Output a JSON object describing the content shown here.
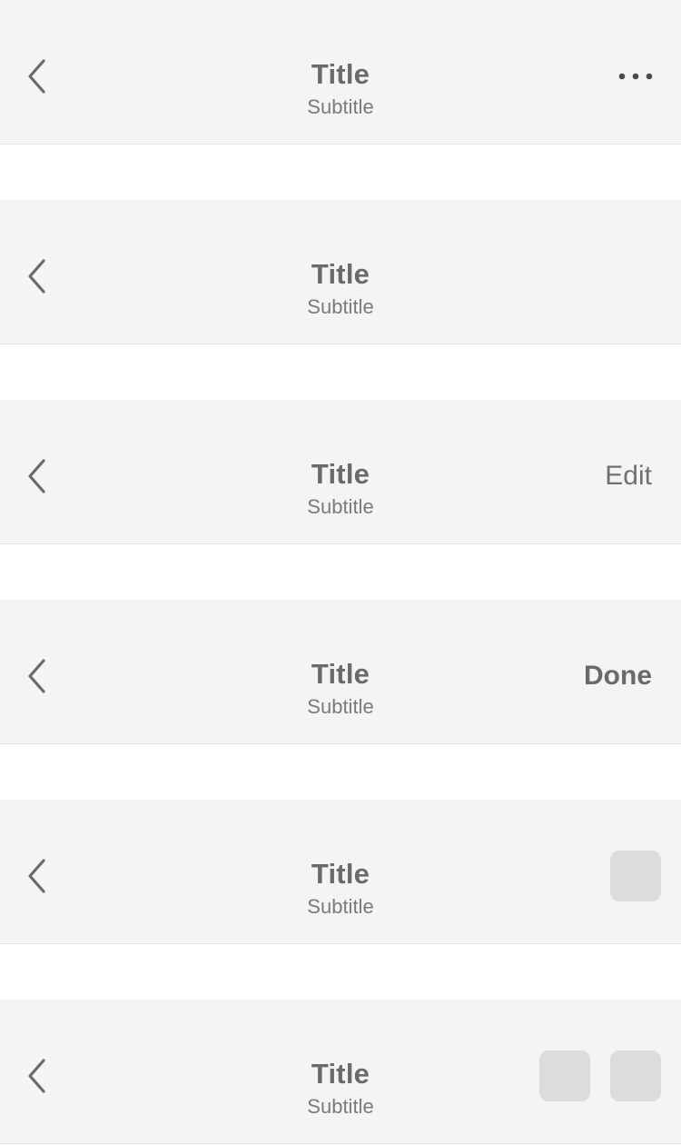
{
  "bars": [
    {
      "title": "Title",
      "subtitle": "Subtitle",
      "right": "more-icon"
    },
    {
      "title": "Title",
      "subtitle": "Subtitle",
      "right": "none"
    },
    {
      "title": "Title",
      "subtitle": "Subtitle",
      "right_text": "Edit"
    },
    {
      "title": "Title",
      "subtitle": "Subtitle",
      "right_text": "Done"
    },
    {
      "title": "Title",
      "subtitle": "Subtitle",
      "right": "one-icon-slot"
    },
    {
      "title": "Title",
      "subtitle": "Subtitle",
      "right": "two-icon-slots"
    }
  ],
  "colors": {
    "bar_background": "#f4f4f4",
    "text": "#6a6a6a",
    "icon_slot": "#dcdcdc",
    "divider": "#e2e2e2"
  },
  "icons": {
    "back": "chevron-left-icon",
    "more": "more-horizontal-icon"
  }
}
